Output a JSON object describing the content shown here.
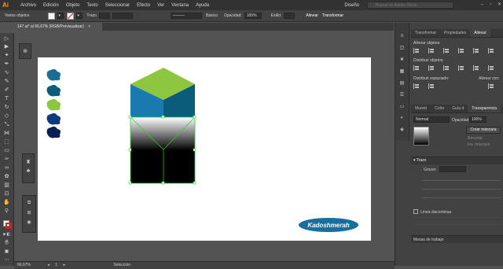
{
  "app": {
    "logo": "Ai"
  },
  "menu": [
    "Archivo",
    "Edición",
    "Objeto",
    "Texto",
    "Seleccionar",
    "Efecto",
    "Ver",
    "Ventana",
    "Ayuda"
  ],
  "workspace": "Diseño",
  "search": {
    "placeholder": "Buscar en Adobe Stock"
  },
  "controlbar": {
    "selection_label": "Varios objetos",
    "stroke_label": "Trazo",
    "stroke_style": "Básico",
    "opacity_label": "Opacidad:",
    "opacity_value": "100%",
    "style_label": "Estilo:",
    "align_label": "Alinear",
    "transform_label": "Transformar"
  },
  "document": {
    "tab_title": "147.ai* al 66,67% (RGB/Previsualizar)",
    "close": "×"
  },
  "statusbar": {
    "zoom": "66,67%",
    "page": "1",
    "tool": "Selección"
  },
  "artboard_text": {
    "logo_text": "Kadoshmerah"
  },
  "colors": {
    "swatches": [
      "#1a6e96",
      "#0a5c7a",
      "#8dc63f",
      "#0a3a82",
      "#0a1f55"
    ],
    "cube_top": "#8dc63f",
    "cube_left": "#1a7ab0",
    "cube_right": "#0a5c7a",
    "ellipse": "#1a6e9e",
    "selection": "#2fd02f"
  },
  "right_panel": {
    "tabs_top": [
      "Transformar",
      "Propiedades",
      "Alinear"
    ],
    "align_objects": "Alinear objetos:",
    "distribute_objects": "Distribuir objetos:",
    "distribute_spacing": "Distribuir espaciado:",
    "align_to": "Alinear con:",
    "tabs_mid": [
      "Muestr",
      "Color",
      "Guía d",
      "Transparencia"
    ],
    "blend_mode": "Normal",
    "opacity_label": "Opacidad:",
    "opacity_value": "100%",
    "make_mask": "Crear máscara",
    "clip": "Recortar",
    "invert_mask": "Inv. máscara",
    "stroke_header": "Trazo",
    "weight_label": "Grosor:",
    "dashed_line": "Línea discontinua",
    "artboards": "Mesas de trabajo"
  }
}
